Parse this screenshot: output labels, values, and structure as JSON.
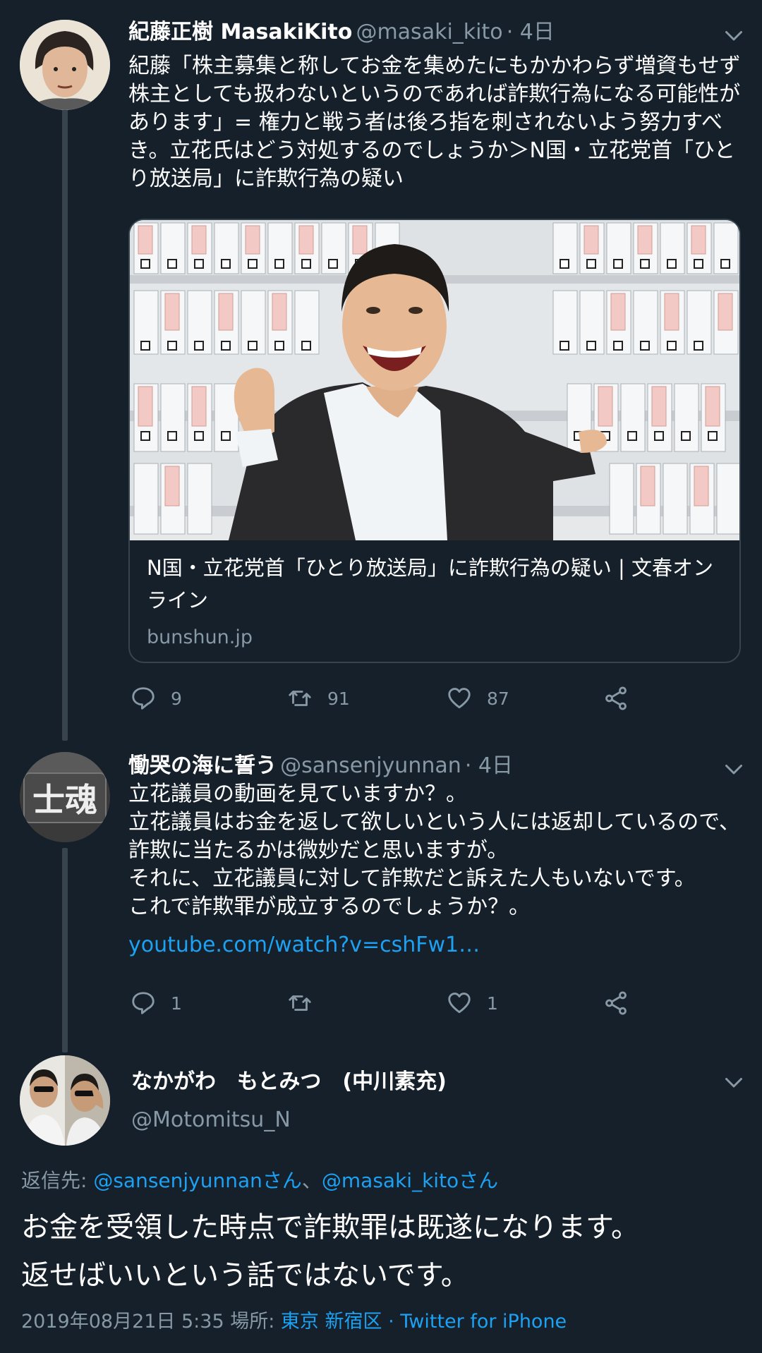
{
  "tweets": [
    {
      "display_name": "紀藤正樹 MasakiKito",
      "handle": "@masaki_kito",
      "time": "· 4日",
      "body": "紀藤「株主募集と称してお金を集めたにもかかわらず増資もせず株主としても扱わないというのであれば詐欺行為になる可能性があります」= 権力と戦う者は後ろ指を刺されないよう努力すべき。立花氏はどう対処するのでしょうか＞N国・立花党首「ひとり放送局」に詐欺行為の疑い",
      "card": {
        "title": "N国・立花党首「ひとり放送局」に詐欺行為の疑い | 文春オンライン",
        "domain": "bunshun.jp"
      },
      "replies": "9",
      "retweets": "91",
      "likes": "87"
    },
    {
      "display_name": "慟哭の海に誓う",
      "handle": "@sansenjyunnan",
      "time": "· 4日",
      "avatar_text": "士魂",
      "body": "立花議員の動画を見ていますか？。\n立花議員はお金を返して欲しいという人には返却しているので、詐欺に当たるかは微妙だと思いますが。\nそれに、立花議員に対して詐欺だと訴えた人もいないです。\nこれで詐欺罪が成立するのでしょうか？。",
      "link": "youtube.com/watch?v=cshFw1…",
      "replies": "1",
      "retweets": "",
      "likes": "1"
    }
  ],
  "main_tweet": {
    "display_name": "なかがわ　もとみつ　(中川素充)",
    "handle": "@Motomitsu_N",
    "reply_to_prefix": "返信先: ",
    "reply_to_user1": "@sansenjyunnanさん",
    "reply_to_sep": "、",
    "reply_to_user2": "@masaki_kitoさん",
    "body_line1": "お金を受領した時点で詐欺罪は既遂になります。",
    "body_line2": "返せばいいという話ではないです。",
    "timestamp": "2019年08月21日 5:35",
    "location_label": " 場所: ",
    "location": "東京 新宿区",
    "source": " · Twitter for iPhone"
  },
  "colors": {
    "background": "#15202b",
    "text": "#ffffff",
    "secondary": "#8899a6",
    "link": "#1da1f2",
    "border": "#38444d"
  }
}
